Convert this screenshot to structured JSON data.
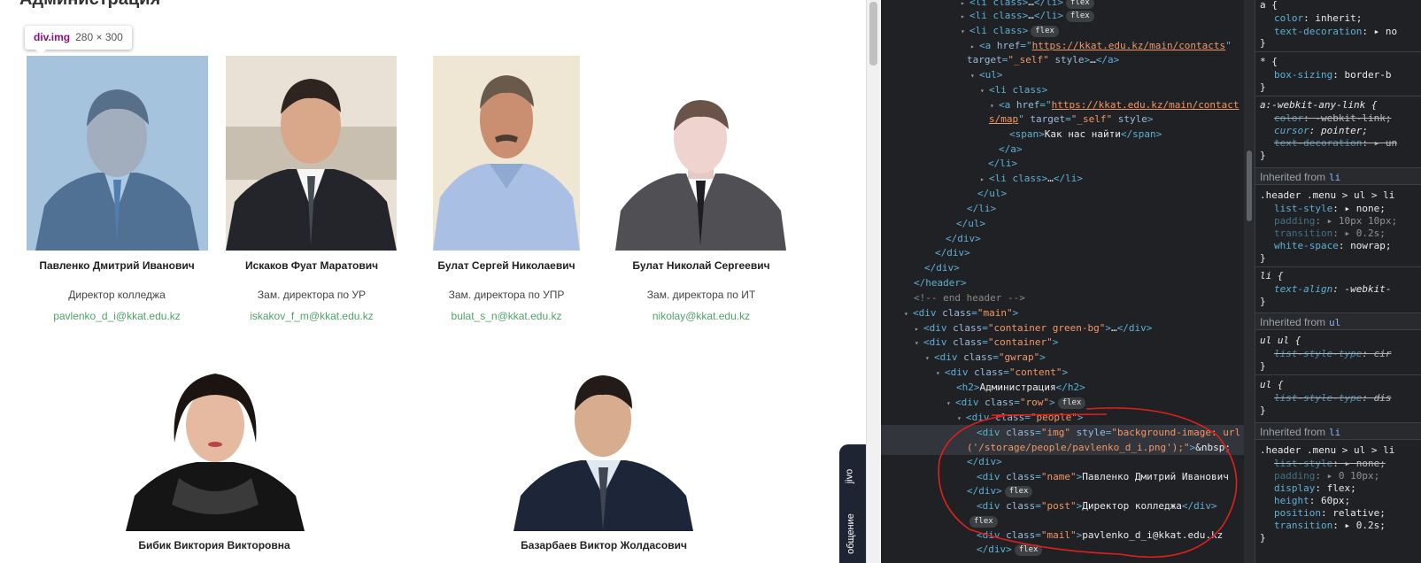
{
  "page": {
    "title": "Администрация",
    "tooltip_tag": "div.img",
    "tooltip_dims": "280 × 300",
    "people": [
      {
        "name": "Павленко Дмитрий Иванович",
        "post": "Директор колледжа",
        "mail": "pavlenko_d_i@kkat.edu.kz"
      },
      {
        "name": "Искаков Фуат Маратович",
        "post": "Зам. директора по УР",
        "mail": "iskakov_f_m@kkat.edu.kz"
      },
      {
        "name": "Булат Сергей Николаевич",
        "post": "Зам. директора по УПР",
        "mail": "bulat_s_n@kkat.edu.kz"
      },
      {
        "name": "Булат Николай Сергеевич",
        "post": "Зам. директора по ИТ",
        "mail": "nikolay@kkat.edu.kz"
      },
      {
        "name": "Бибик Виктория Викторовна"
      },
      {
        "name": "Базарбаев Виктор Жолдасович"
      }
    ],
    "jivo_label": "jivo",
    "jivo_label2": "общение"
  },
  "devtools": {
    "elements": {
      "flex_badge": "flex",
      "url_contacts": "https://kkat.edu.kz/main/contacts",
      "url_map_1": "https://kkat.edu.kz/main/contact",
      "url_map_2": "s/map",
      "span_text": "Как нас найти",
      "comment": "<!-- end header -->",
      "h2_text": "Администрация",
      "img_style_1": "background-image: url",
      "img_style_2": "('/storage/people/pavlenko_d_i.png');",
      "nbsp": "&nbsp;",
      "name_text": "Павленко Дмитрий Иванович",
      "post_text": "Директор колледжа",
      "mail_text": "pavlenko_d_i@kkat.edu.kz"
    },
    "styles": {
      "rules": [
        {
          "selector": "a {",
          "props": [
            [
              "color",
              "inherit;"
            ],
            [
              "text-decoration",
              "▸ no"
            ]
          ]
        },
        {
          "selector": "* {",
          "props": [
            [
              "box-sizing",
              "border-b"
            ]
          ]
        },
        {
          "selector": "a:-webkit-any-link {",
          "props": [
            [
              "color",
              "-webkit-link;"
            ],
            [
              "cursor",
              "pointer;"
            ],
            [
              "text-decoration",
              "▸ un"
            ]
          ]
        },
        {
          "selector": ".header .menu > ul > li",
          "props": [
            [
              "list-style",
              "▸ none;"
            ],
            [
              "padding",
              "▸ 10px 10px;"
            ],
            [
              "transition",
              "▸ 0.2s;"
            ],
            [
              "white-space",
              "nowrap;"
            ]
          ]
        },
        {
          "selector": "li {",
          "props": [
            [
              "text-align",
              "-webkit-"
            ]
          ]
        },
        {
          "selector": "ul ul {",
          "props": [
            [
              "list-style-type",
              "cir"
            ]
          ]
        },
        {
          "selector": "ul {",
          "props": [
            [
              "list-style-type",
              "dis"
            ]
          ]
        },
        {
          "selector": ".header .menu > ul > li",
          "props": [
            [
              "list-style",
              "▸ none;"
            ],
            [
              "padding",
              "▸ 0 10px;"
            ],
            [
              "display",
              "flex;"
            ],
            [
              "height",
              "60px;"
            ],
            [
              "position",
              "relative;"
            ],
            [
              "transition",
              "▸ 0.2s;"
            ]
          ]
        }
      ],
      "inherited_label": "Inherited from",
      "inherited_li": "li",
      "inherited_ul": "ul"
    }
  }
}
